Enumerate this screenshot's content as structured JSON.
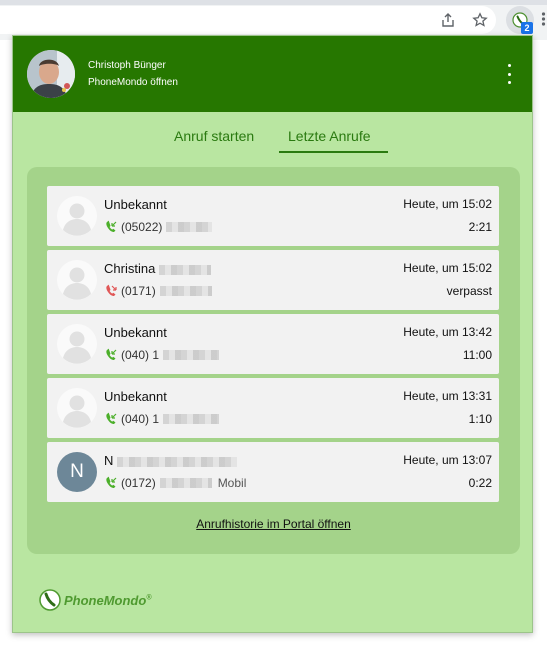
{
  "browser": {
    "share_icon": "share-icon",
    "star_icon": "star-icon",
    "extension_icon": "phonemondo-extension-icon",
    "extension_badge": "2",
    "more_icon": "kebab-icon"
  },
  "header": {
    "user_name": "Christoph Bünger",
    "open_app_label": "PhoneMondo öffnen",
    "avatar_icon": "user-photo",
    "menu_icon": "kebab-menu-icon",
    "background_color": "#267700"
  },
  "tabs": [
    {
      "label": "Anruf starten",
      "active": false
    },
    {
      "label": "Letzte Anrufe",
      "active": true
    }
  ],
  "calls": [
    {
      "name": "Unbekannt",
      "number": "(05022)",
      "time": "Heute, um 15:02",
      "duration": "2:21",
      "status": "incoming",
      "avatar": "placeholder"
    },
    {
      "name": "Christina",
      "number": "(0171)",
      "time": "Heute, um 15:02",
      "duration": "verpasst",
      "status": "missed",
      "avatar": "placeholder"
    },
    {
      "name": "Unbekannt",
      "number": "(040) 1",
      "time": "Heute, um 13:42",
      "duration": "11:00",
      "status": "incoming",
      "avatar": "placeholder"
    },
    {
      "name": "Unbekannt",
      "number": "(040) 1",
      "time": "Heute, um 13:31",
      "duration": "1:10",
      "status": "incoming",
      "avatar": "placeholder"
    },
    {
      "name": "N",
      "number": "(0172)",
      "label": "Mobil",
      "time": "Heute, um 13:07",
      "duration": "0:22",
      "status": "incoming",
      "avatar": "letter",
      "avatar_letter": "N"
    }
  ],
  "history_link": "Anrufhistorie im Portal öffnen",
  "brand": {
    "name": "PhoneMondo",
    "trademark": "®"
  },
  "colors": {
    "popup_bg": "#b9e6a1",
    "panel_bg": "#a4d38a",
    "accent": "#2a7a10",
    "incoming_icon": "#4caf2a",
    "missed_icon": "#e05656"
  }
}
